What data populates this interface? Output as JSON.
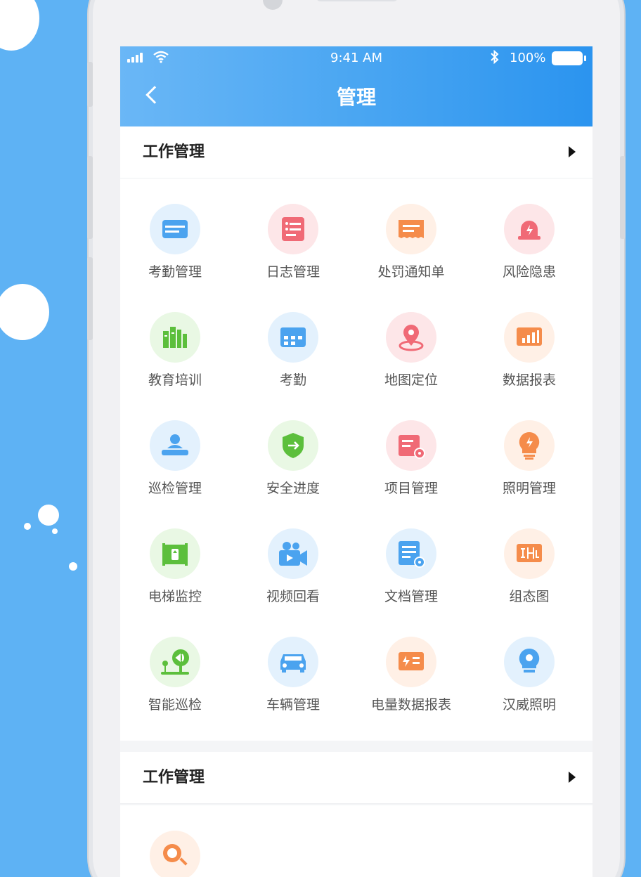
{
  "status_bar": {
    "time": "9:41 AM",
    "battery": "100%"
  },
  "header": {
    "title": "管理"
  },
  "sections": [
    {
      "title": "工作管理"
    },
    {
      "title": "工作管理"
    }
  ],
  "grid": [
    {
      "label": "考勤管理",
      "icon": "card-icon",
      "bg": "#e3f1fd",
      "fg": "#4ba3ef"
    },
    {
      "label": "日志管理",
      "icon": "log-icon",
      "bg": "#fde6e8",
      "fg": "#f06a76"
    },
    {
      "label": "处罚通知单",
      "icon": "ticket-icon",
      "bg": "#fff0e6",
      "fg": "#f58c4b"
    },
    {
      "label": "风险隐患",
      "icon": "alarm-icon",
      "bg": "#fde6e8",
      "fg": "#f06a76"
    },
    {
      "label": "教育培训",
      "icon": "books-icon",
      "bg": "#e9f8e4",
      "fg": "#5cbf3c"
    },
    {
      "label": "考勤",
      "icon": "calendar-icon",
      "bg": "#e3f1fd",
      "fg": "#4ba3ef"
    },
    {
      "label": "地图定位",
      "icon": "location-pin-icon",
      "bg": "#fde6e8",
      "fg": "#f06a76"
    },
    {
      "label": "数据报表",
      "icon": "bar-chart-icon",
      "bg": "#fff0e6",
      "fg": "#f58c4b"
    },
    {
      "label": "巡检管理",
      "icon": "inspector-icon",
      "bg": "#e3f1fd",
      "fg": "#4ba3ef"
    },
    {
      "label": "安全进度",
      "icon": "shield-icon",
      "bg": "#e9f8e4",
      "fg": "#5cbf3c"
    },
    {
      "label": "项目管理",
      "icon": "project-folder-icon",
      "bg": "#fde6e8",
      "fg": "#f06a76"
    },
    {
      "label": "照明管理",
      "icon": "bulb-icon",
      "bg": "#fff0e6",
      "fg": "#f58c4b"
    },
    {
      "label": "电梯监控",
      "icon": "elevator-icon",
      "bg": "#e9f8e4",
      "fg": "#5cbf3c"
    },
    {
      "label": "视频回看",
      "icon": "video-camera-icon",
      "bg": "#e3f1fd",
      "fg": "#4ba3ef"
    },
    {
      "label": "文档管理",
      "icon": "document-icon",
      "bg": "#e3f1fd",
      "fg": "#4ba3ef"
    },
    {
      "label": "组态图",
      "icon": "diagram-icon",
      "bg": "#fff0e6",
      "fg": "#f58c4b"
    },
    {
      "label": "智能巡检",
      "icon": "smart-patrol-icon",
      "bg": "#e9f8e4",
      "fg": "#5cbf3c"
    },
    {
      "label": "车辆管理",
      "icon": "car-icon",
      "bg": "#e3f1fd",
      "fg": "#4ba3ef"
    },
    {
      "label": "电量数据报表",
      "icon": "power-report-icon",
      "bg": "#fff0e6",
      "fg": "#f58c4b"
    },
    {
      "label": "汉威照明",
      "icon": "lamp-icon",
      "bg": "#e3f1fd",
      "fg": "#4ba3ef"
    }
  ],
  "second_grid": [
    {
      "label": "",
      "icon": "search-doc-icon",
      "bg": "#fff0e6",
      "fg": "#f58c4b"
    }
  ]
}
